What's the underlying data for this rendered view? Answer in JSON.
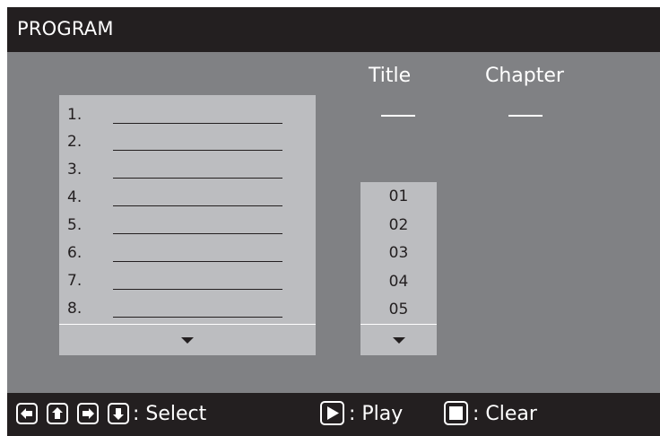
{
  "header": {
    "title": "PROGRAM"
  },
  "columns": {
    "title": "Title",
    "chapter": "Chapter"
  },
  "selection": {
    "title_value": "___",
    "chapter_value": "___"
  },
  "program_slots": [
    {
      "num": "1."
    },
    {
      "num": "2."
    },
    {
      "num": "3."
    },
    {
      "num": "4."
    },
    {
      "num": "5."
    },
    {
      "num": "6."
    },
    {
      "num": "7."
    },
    {
      "num": "8."
    }
  ],
  "title_options": [
    "01",
    "02",
    "03",
    "04",
    "05"
  ],
  "footer": {
    "select_label": ": Select",
    "play_label": ": Play",
    "clear_label": ": Clear"
  },
  "icons": {
    "left": "arrow-left-icon",
    "up": "arrow-up-icon",
    "right": "arrow-right-icon",
    "down": "arrow-down-icon",
    "play": "play-icon",
    "stop": "stop-icon"
  },
  "colors": {
    "background": "#808184",
    "header": "#231f20",
    "list": "#bcbdc0",
    "text_light": "#ffffff",
    "text_dark": "#231f20"
  }
}
